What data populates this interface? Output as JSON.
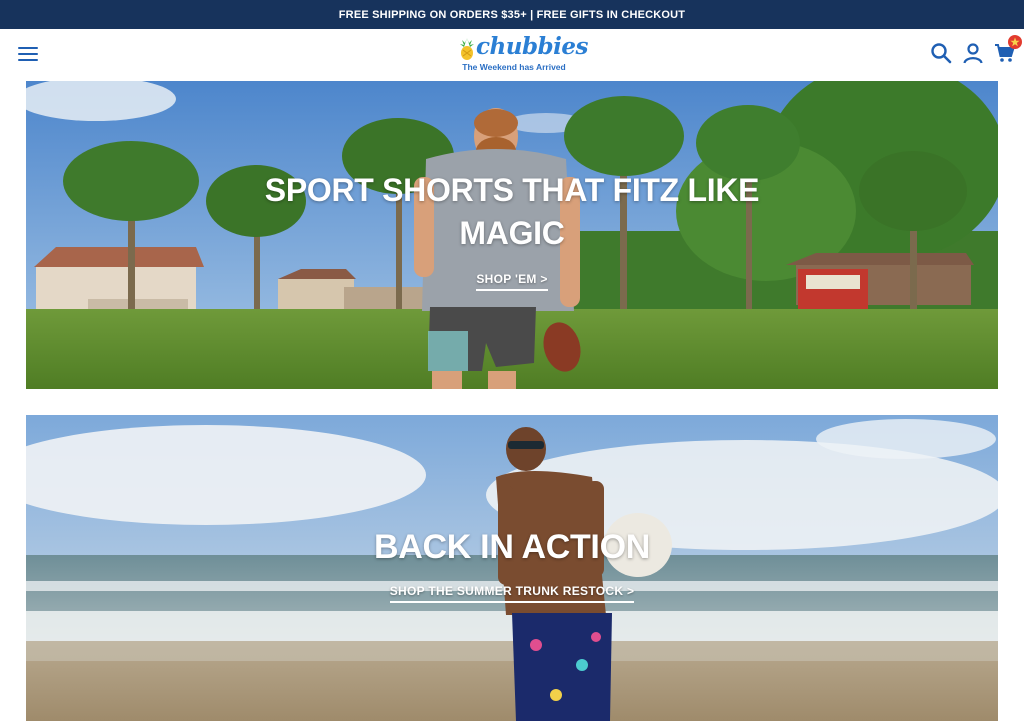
{
  "announcement": {
    "text": "FREE SHIPPING ON ORDERS $35+ | FREE GIFTS IN CHECKOUT"
  },
  "header": {
    "menu_icon": "hamburger-menu-icon",
    "logo": {
      "word": "chubbies",
      "tagline": "The Weekend has Arrived"
    },
    "icons": [
      "search-icon",
      "account-icon",
      "cart-icon"
    ],
    "cart_badge_icon": "star-icon"
  },
  "heroes": [
    {
      "title": "SPORT SHORTS THAT FITZ LIKE MAGIC",
      "link": "SHOP 'EM >"
    },
    {
      "title": "BACK IN ACTION",
      "link": "SHOP THE SUMMER TRUNK RESTOCK >"
    }
  ],
  "colors": {
    "announcement_bg": "#17335c",
    "brand_blue": "#2b7fd4",
    "badge_red": "#e23b2e"
  }
}
